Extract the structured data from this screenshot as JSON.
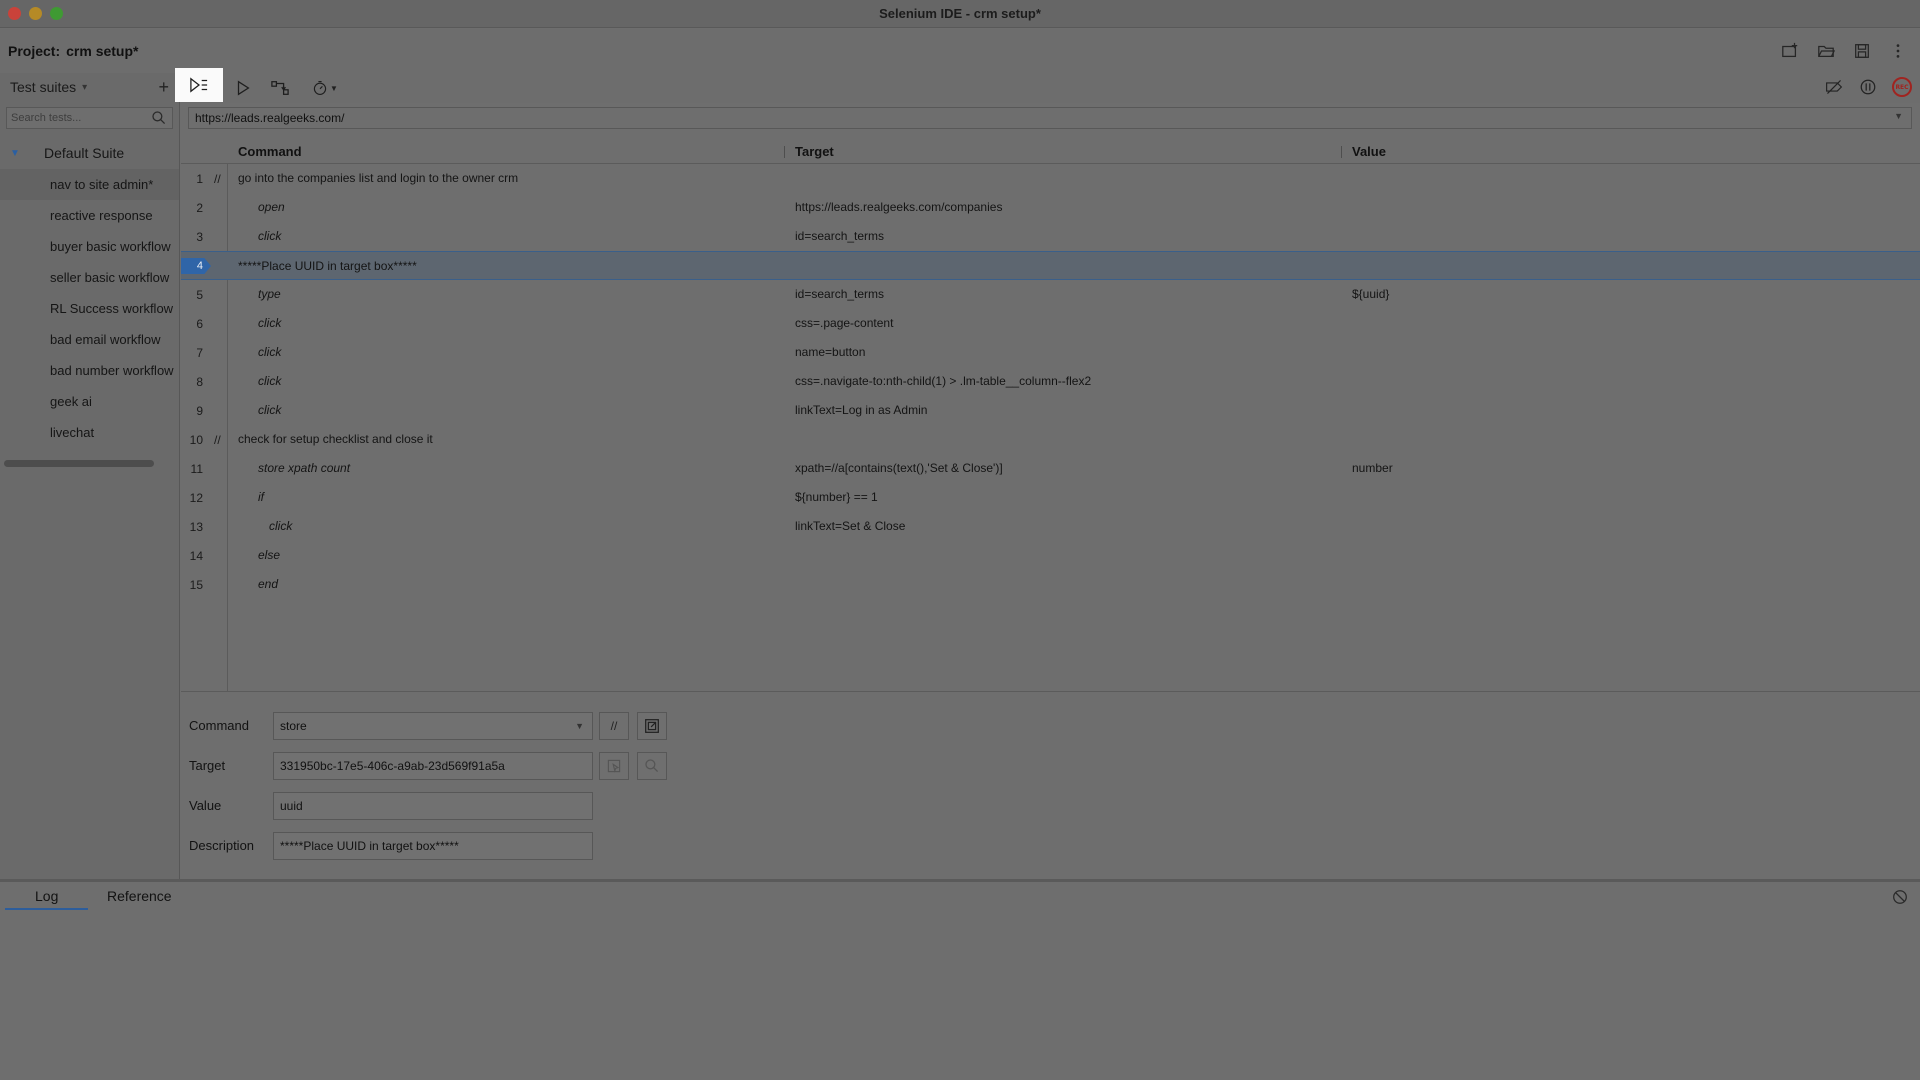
{
  "window": {
    "title": "Selenium IDE - crm setup*"
  },
  "project": {
    "label": "Project:",
    "name": "crm setup*"
  },
  "project_actions": [
    {
      "icon": "new-project-icon"
    },
    {
      "icon": "open-project-icon"
    },
    {
      "icon": "save-project-icon"
    },
    {
      "icon": "more-options-icon"
    }
  ],
  "sidebar": {
    "header_label": "Test suites",
    "add_label": "+",
    "search_placeholder": "Search tests...",
    "suite_name": "Default Suite",
    "tests": [
      {
        "label": "nav to site admin*"
      },
      {
        "label": "reactive response"
      },
      {
        "label": "buyer basic workflow"
      },
      {
        "label": "seller basic workflow"
      },
      {
        "label": "RL Success workflow"
      },
      {
        "label": "bad email workflow"
      },
      {
        "label": "bad number workflow"
      },
      {
        "label": "geek ai"
      },
      {
        "label": "livechat"
      }
    ],
    "selected_test_index": 0
  },
  "toolbar": {
    "buttons": [
      {
        "icon": "run-all-tests-icon"
      },
      {
        "icon": "run-current-test-icon"
      },
      {
        "icon": "step-over-icon"
      },
      {
        "icon": "test-speed-icon"
      }
    ],
    "right_buttons": [
      {
        "icon": "disable-breakpoints-icon"
      },
      {
        "icon": "pause-on-exceptions-icon"
      },
      {
        "icon": "record-icon",
        "label": "REC"
      }
    ]
  },
  "url": {
    "value": "https://leads.realgeeks.com/"
  },
  "table": {
    "headers": {
      "command": "Command",
      "target": "Target",
      "value": "Value"
    },
    "rows": [
      {
        "num": "1",
        "comment_marker": "//",
        "command": "go into the companies list and login to the owner crm",
        "target": "",
        "value": "",
        "is_comment": true,
        "indent": 0
      },
      {
        "num": "2",
        "comment_marker": "",
        "command": "open",
        "target": "https://leads.realgeeks.com/companies",
        "value": "",
        "is_comment": false,
        "indent": 1
      },
      {
        "num": "3",
        "comment_marker": "",
        "command": "click",
        "target": "id=search_terms",
        "value": "",
        "is_comment": false,
        "indent": 1
      },
      {
        "num": "4",
        "comment_marker": "",
        "command": "*****Place UUID in target box*****",
        "target": "",
        "value": "",
        "is_comment": true,
        "indent": 0,
        "selected": true
      },
      {
        "num": "5",
        "comment_marker": "",
        "command": "type",
        "target": "id=search_terms",
        "value": "${uuid}",
        "is_comment": false,
        "indent": 1
      },
      {
        "num": "6",
        "comment_marker": "",
        "command": "click",
        "target": "css=.page-content",
        "value": "",
        "is_comment": false,
        "indent": 1
      },
      {
        "num": "7",
        "comment_marker": "",
        "command": "click",
        "target": "name=button",
        "value": "",
        "is_comment": false,
        "indent": 1
      },
      {
        "num": "8",
        "comment_marker": "",
        "command": "click",
        "target": "css=.navigate-to:nth-child(1) > .lm-table__column--flex2",
        "value": "",
        "is_comment": false,
        "indent": 1
      },
      {
        "num": "9",
        "comment_marker": "",
        "command": "click",
        "target": "linkText=Log in as Admin",
        "value": "",
        "is_comment": false,
        "indent": 1
      },
      {
        "num": "10",
        "comment_marker": "//",
        "command": "check for setup checklist and close it",
        "target": "",
        "value": "",
        "is_comment": true,
        "indent": 0
      },
      {
        "num": "11",
        "comment_marker": "",
        "command": "store xpath count",
        "target": "xpath=//a[contains(text(),'Set & Close')]",
        "value": "number",
        "is_comment": false,
        "indent": 1
      },
      {
        "num": "12",
        "comment_marker": "",
        "command": "if",
        "target": "${number} == 1",
        "value": "",
        "is_comment": false,
        "indent": 1
      },
      {
        "num": "13",
        "comment_marker": "",
        "command": "click",
        "target": "linkText=Set & Close",
        "value": "",
        "is_comment": false,
        "indent": 2
      },
      {
        "num": "14",
        "comment_marker": "",
        "command": "else",
        "target": "",
        "value": "",
        "is_comment": false,
        "indent": 1
      },
      {
        "num": "15",
        "comment_marker": "",
        "command": "end",
        "target": "",
        "value": "",
        "is_comment": false,
        "indent": 1
      }
    ]
  },
  "editor": {
    "command_label": "Command",
    "command_value": "store",
    "comment_toggle_label": "//",
    "target_label": "Target",
    "target_value": "331950bc-17e5-406c-a9ab-23d569f91a5a",
    "value_label": "Value",
    "value_value": "uuid",
    "description_label": "Description",
    "description_value": "*****Place UUID in target box*****"
  },
  "bottom_panel": {
    "tabs": [
      {
        "label": "Log"
      },
      {
        "label": "Reference"
      }
    ],
    "active_tab": 0
  },
  "colors": {
    "accent": "#2f65a8",
    "record": "#a02420"
  }
}
